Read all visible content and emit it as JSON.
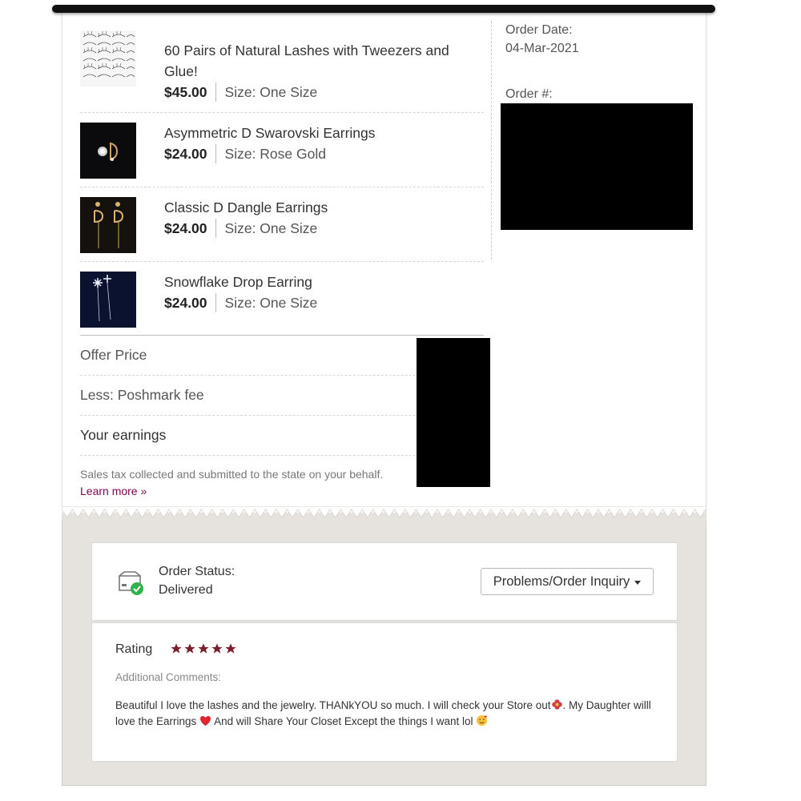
{
  "items": [
    {
      "title": "60 Pairs of Natural Lashes with Tweezers and Glue!",
      "price": "$45.00",
      "size": "Size: One Size",
      "image_icon": "lashes-thumbnail"
    },
    {
      "title": "Asymmetric D Swarovski Earrings",
      "price": "$24.00",
      "size": "Size: Rose Gold",
      "image_icon": "earrings-thumbnail"
    },
    {
      "title": "Classic D Dangle Earrings",
      "price": "$24.00",
      "size": "Size: One Size",
      "image_icon": "dangle-earrings-thumbnail"
    },
    {
      "title": "Snowflake Drop Earring",
      "price": "$24.00",
      "size": "Size: One Size",
      "image_icon": "snowflake-earring-thumbnail"
    }
  ],
  "order": {
    "date_label": "Order Date:",
    "date_value": "04-Mar-2021",
    "number_label": "Order #:"
  },
  "totals": {
    "offer_price": "Offer Price",
    "poshmark_fee": "Less: Poshmark fee",
    "earnings": "Your earnings",
    "tax_note": "Sales tax collected and submitted to the state on your behalf.",
    "learn_more": "Learn more »"
  },
  "status": {
    "label": "Order Status:",
    "value": "Delivered",
    "icon": "box-delivered-icon",
    "inquiry_button": "Problems/Order Inquiry"
  },
  "rating": {
    "label": "Rating",
    "stars": 5,
    "comments_label": "Additional Comments:",
    "comment_part1": "Beautiful I love the lashes and the jewelry. THANkYOU so much. I will check your Store out",
    "comment_part2": ". My Daughter willl love the Earrings ",
    "comment_part3": " And will Share Your Closet Except the things I want lol "
  },
  "colors": {
    "brand": "#7f0353",
    "star": "#7a1f2e",
    "check": "#2fb24c",
    "lower_bg": "#e6e2de"
  }
}
